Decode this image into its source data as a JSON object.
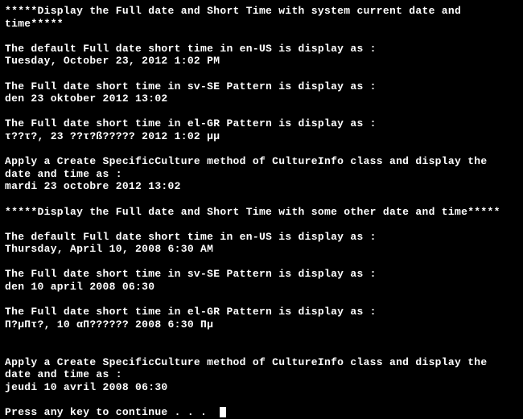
{
  "section1": {
    "header": "*****Display the Full date and Short Time with system current date and time*****",
    "enUS": {
      "label": "The default Full date short time in en-US is display as :",
      "value": "Tuesday, October 23, 2012 1:02 PM"
    },
    "svSE": {
      "label": "The Full date short time in sv-SE Pattern is display as :",
      "value": "den 23 oktober 2012 13:02"
    },
    "elGR": {
      "label": "The Full date short time in el-GR Pattern is display as :",
      "value": "τ??τ?, 23 ??τ?ß????? 2012 1:02 μμ"
    },
    "specific": {
      "label": "Apply a Create SpecificCulture method of CultureInfo class and display the date and time as :",
      "value": "mardi 23 octobre 2012 13:02"
    }
  },
  "section2": {
    "header": "*****Display the Full date and Short Time with some other date and time*****",
    "enUS": {
      "label": "The default Full date short time in en-US is display as :",
      "value": "Thursday, April 10, 2008 6:30 AM"
    },
    "svSE": {
      "label": "The Full date short time in sv-SE Pattern is display as :",
      "value": "den 10 april 2008 06:30"
    },
    "elGR": {
      "label": "The Full date short time in el-GR Pattern is display as :",
      "value": "Π?μΠτ?, 10 αΠ?????? 2008 6:30 Πμ"
    },
    "specific": {
      "label": "Apply a Create SpecificCulture method of CultureInfo class and display the date and time as :",
      "value": "jeudi 10 avril 2008 06:30"
    }
  },
  "prompt": "Press any key to continue . . . "
}
